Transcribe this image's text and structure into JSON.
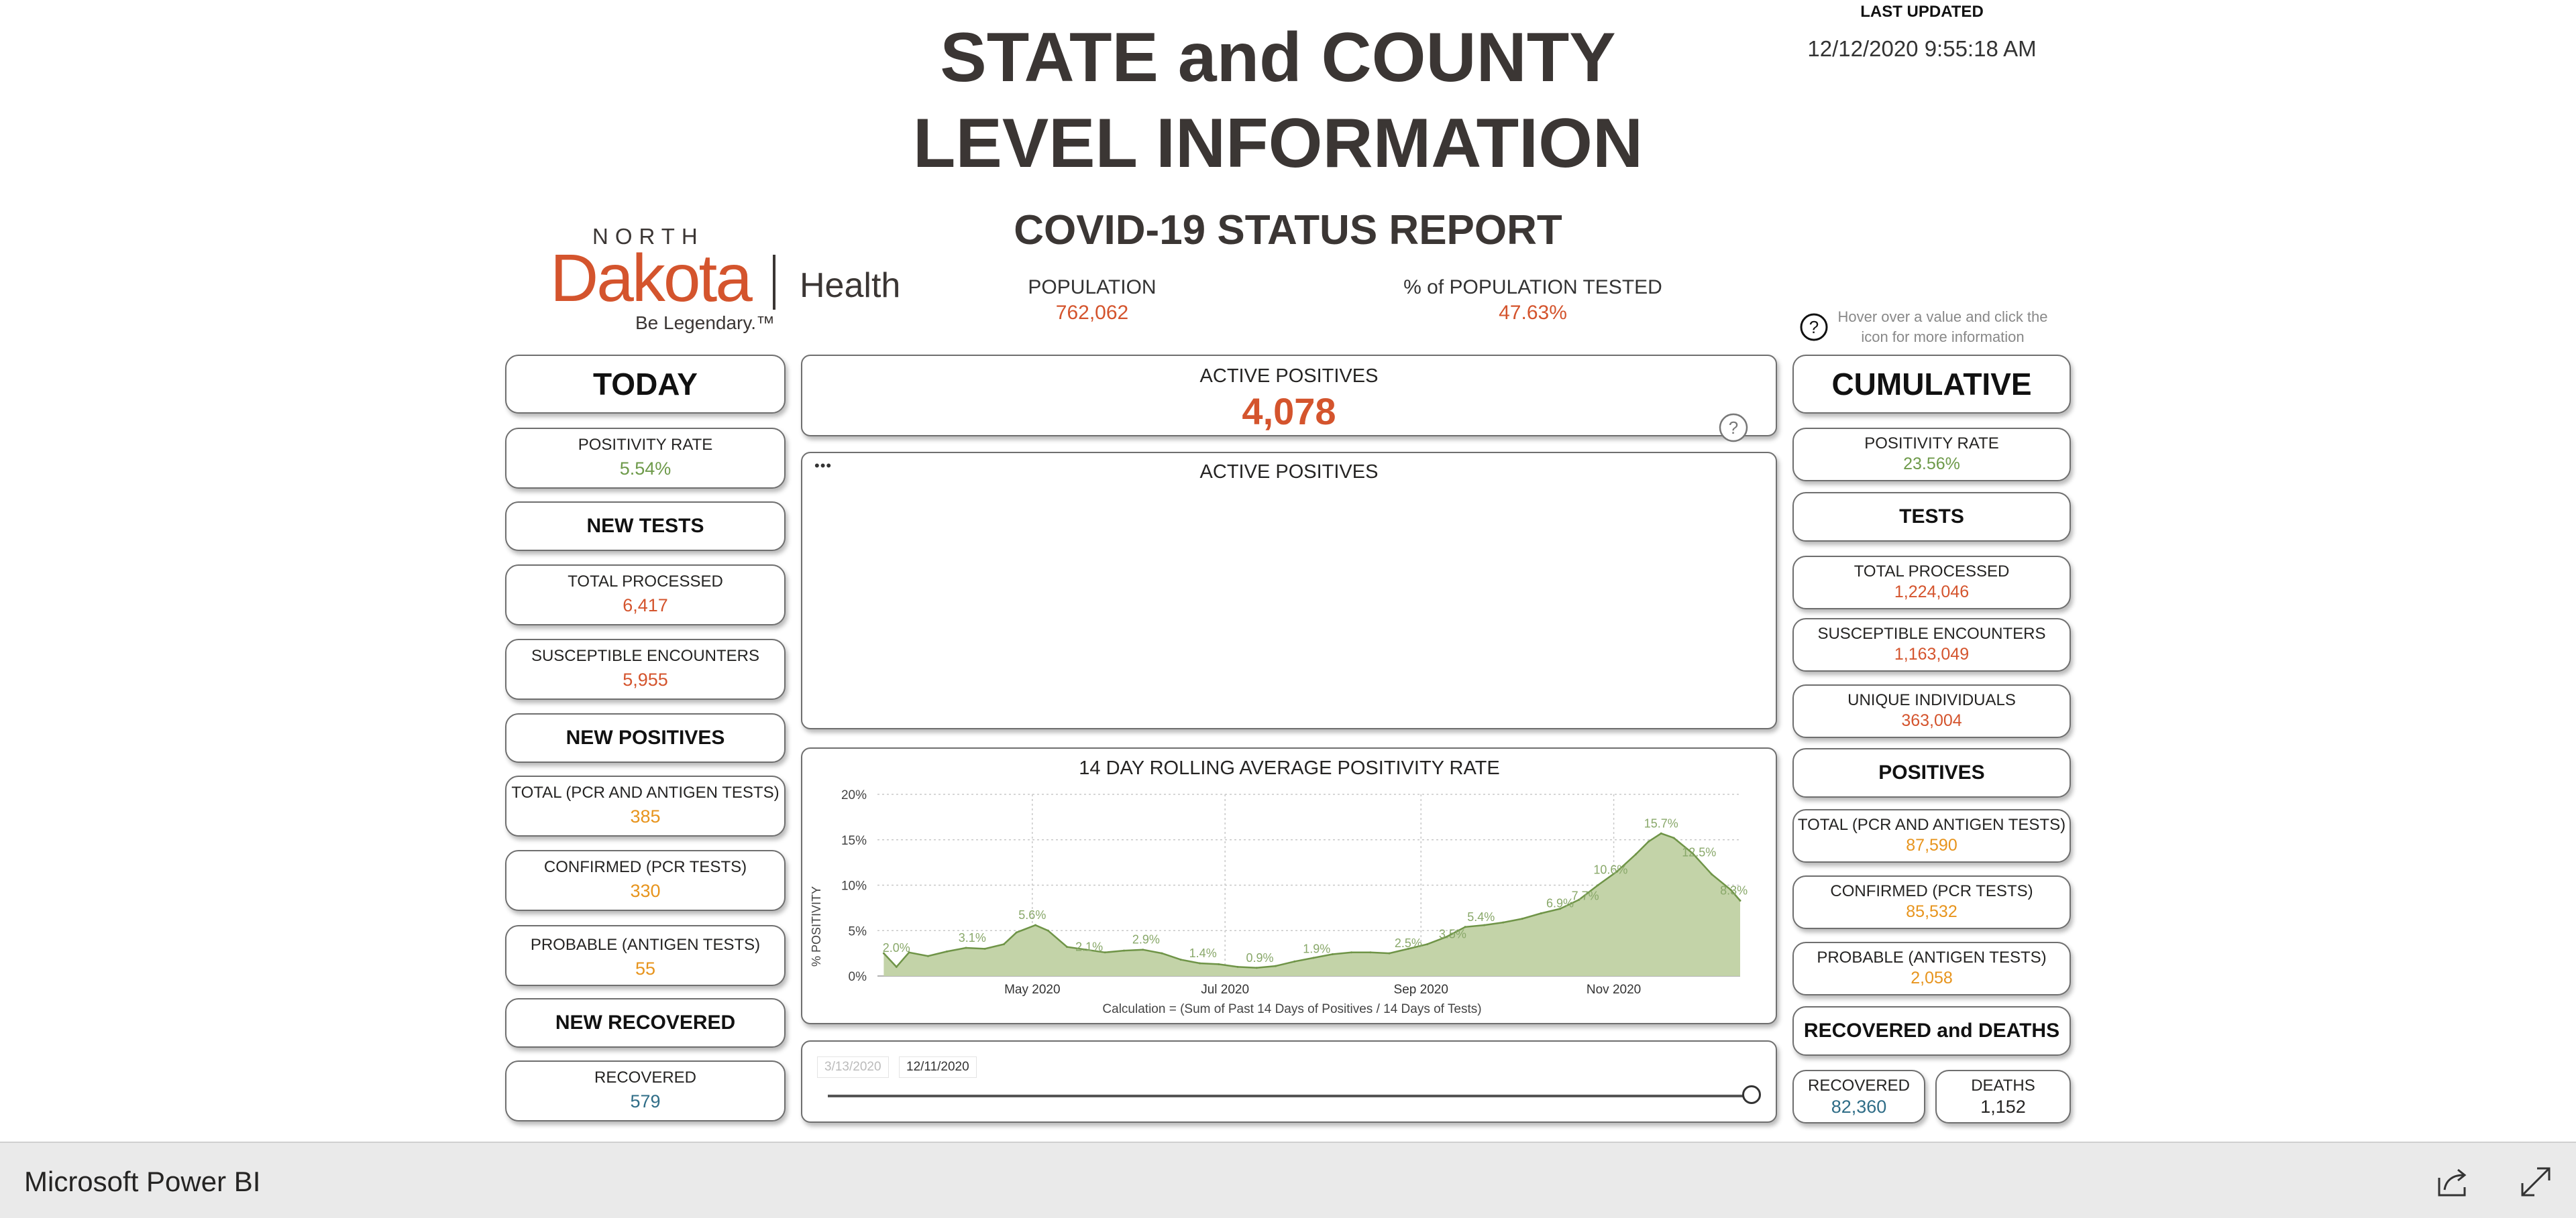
{
  "header": {
    "title_line1": "STATE and COUNTY",
    "title_line2": "LEVEL INFORMATION",
    "last_updated_label": "LAST UPDATED",
    "last_updated_value": "12/12/2020 9:55:18 AM"
  },
  "logo": {
    "north": "NORTH",
    "dakota": "Dakota",
    "health": "Health",
    "tagline": "Be Legendary.™"
  },
  "report": {
    "title": "COVID-19 STATUS REPORT",
    "population_label": "POPULATION",
    "population_value": "762,062",
    "pct_tested_label": "% of POPULATION TESTED",
    "pct_tested_value": "47.63%",
    "hint": "Hover over a value and click the icon for more information"
  },
  "today": {
    "title": "TODAY",
    "positivity_label": "POSITIVITY RATE",
    "positivity_value": "5.54%",
    "new_tests_title": "NEW TESTS",
    "total_processed_label": "TOTAL PROCESSED",
    "total_processed_value": "6,417",
    "susceptible_label": "SUSCEPTIBLE ENCOUNTERS",
    "susceptible_value": "5,955",
    "new_positives_title": "NEW POSITIVES",
    "total_label": "TOTAL (PCR AND ANTIGEN TESTS)",
    "total_value": "385",
    "confirmed_label": "CONFIRMED (PCR TESTS)",
    "confirmed_value": "330",
    "probable_label": "PROBABLE (ANTIGEN TESTS)",
    "probable_value": "55",
    "new_recovered_title": "NEW RECOVERED",
    "recovered_label": "RECOVERED",
    "recovered_value": "579"
  },
  "active": {
    "label": "ACTIVE POSITIVES",
    "value": "4,078",
    "panel_title": "ACTIVE POSITIVES"
  },
  "cumulative": {
    "title": "CUMULATIVE",
    "positivity_label": "POSITIVITY RATE",
    "positivity_value": "23.56%",
    "tests_title": "TESTS",
    "total_processed_label": "TOTAL PROCESSED",
    "total_processed_value": "1,224,046",
    "susceptible_label": "SUSCEPTIBLE ENCOUNTERS",
    "susceptible_value": "1,163,049",
    "unique_label": "UNIQUE INDIVIDUALS",
    "unique_value": "363,004",
    "positives_title": "POSITIVES",
    "total_label": "TOTAL (PCR AND ANTIGEN TESTS)",
    "total_value": "87,590",
    "confirmed_label": "CONFIRMED (PCR TESTS)",
    "confirmed_value": "85,532",
    "probable_label": "PROBABLE (ANTIGEN TESTS)",
    "probable_value": "2,058",
    "rec_deaths_title": "RECOVERED and DEATHS",
    "recovered_label": "RECOVERED",
    "recovered_value": "82,360",
    "deaths_label": "DEATHS",
    "deaths_value": "1,152"
  },
  "slider": {
    "start": "3/13/2020",
    "end": "12/11/2020",
    "position": 1.0
  },
  "footer": {
    "app_name": "Microsoft Power BI"
  },
  "icons": {
    "help": "help-circle-icon",
    "share": "share-icon",
    "fullscreen": "expand-icon",
    "more": "more-options-icon"
  },
  "colors": {
    "accent_red": "#d4542d",
    "accent_green": "#6e9a4a",
    "accent_orange": "#e7941d",
    "area_fill": "#c3d3a8",
    "area_line": "#6f9447"
  },
  "chart_data": {
    "type": "area",
    "title": "14 DAY ROLLING AVERAGE POSITIVITY RATE",
    "ylabel": "% POSITIVITY",
    "xlabel": "",
    "note": "Calculation = (Sum of Past 14 Days of Positives / 14 Days of Tests)",
    "ylim": [
      0,
      20
    ],
    "y_ticks": [
      "0%",
      "5%",
      "10%",
      "15%",
      "20%"
    ],
    "x_ticks": [
      {
        "date": "2020-05-01",
        "label": "May 2020"
      },
      {
        "date": "2020-07-01",
        "label": "Jul 2020"
      },
      {
        "date": "2020-09-01",
        "label": "Sep 2020"
      },
      {
        "date": "2020-11-01",
        "label": "Nov 2020"
      }
    ],
    "grid": true,
    "series": [
      {
        "x": [
          "2020-03-15",
          "2020-03-19",
          "2020-03-23",
          "2020-03-29",
          "2020-04-04",
          "2020-04-10",
          "2020-04-16",
          "2020-04-22",
          "2020-04-26",
          "2020-05-02",
          "2020-05-06",
          "2020-05-12",
          "2020-05-18",
          "2020-05-24",
          "2020-05-30",
          "2020-06-05",
          "2020-06-11",
          "2020-06-17",
          "2020-06-23",
          "2020-06-29",
          "2020-07-05",
          "2020-07-11",
          "2020-07-17",
          "2020-07-23",
          "2020-07-29",
          "2020-08-04",
          "2020-08-10",
          "2020-08-16",
          "2020-08-22",
          "2020-08-28",
          "2020-09-03",
          "2020-09-09",
          "2020-09-15",
          "2020-09-21",
          "2020-09-27",
          "2020-10-03",
          "2020-10-09",
          "2020-10-15",
          "2020-10-21",
          "2020-10-27",
          "2020-11-02",
          "2020-11-08",
          "2020-11-12",
          "2020-11-16",
          "2020-11-20",
          "2020-11-26",
          "2020-12-02",
          "2020-12-08",
          "2020-12-11"
        ],
        "values": [
          2.5,
          1.0,
          2.6,
          2.2,
          2.7,
          3.1,
          3.0,
          3.5,
          4.8,
          5.6,
          5.0,
          3.2,
          2.9,
          2.6,
          2.8,
          2.9,
          2.5,
          1.8,
          1.4,
          1.3,
          1.0,
          0.9,
          1.1,
          1.6,
          2.0,
          2.4,
          2.6,
          2.6,
          2.5,
          3.0,
          3.5,
          4.3,
          5.4,
          5.6,
          5.9,
          6.3,
          6.9,
          7.4,
          8.4,
          10.0,
          11.5,
          13.4,
          14.8,
          15.7,
          15.2,
          13.5,
          11.2,
          9.5,
          8.3
        ]
      }
    ],
    "data_labels": [
      {
        "date": "2020-03-19",
        "value": 2.0,
        "text": "2.0%"
      },
      {
        "date": "2020-04-12",
        "value": 3.1,
        "text": "3.1%"
      },
      {
        "date": "2020-05-01",
        "value": 5.6,
        "text": "5.6%"
      },
      {
        "date": "2020-05-19",
        "value": 2.1,
        "text": "2.1%"
      },
      {
        "date": "2020-06-06",
        "value": 2.9,
        "text": "2.9%"
      },
      {
        "date": "2020-06-24",
        "value": 1.4,
        "text": "1.4%"
      },
      {
        "date": "2020-07-12",
        "value": 0.9,
        "text": "0.9%"
      },
      {
        "date": "2020-07-30",
        "value": 1.9,
        "text": "1.9%"
      },
      {
        "date": "2020-08-28",
        "value": 2.5,
        "text": "2.5%"
      },
      {
        "date": "2020-09-11",
        "value": 3.5,
        "text": "3.5%"
      },
      {
        "date": "2020-09-20",
        "value": 5.4,
        "text": "5.4%"
      },
      {
        "date": "2020-10-15",
        "value": 6.9,
        "text": "6.9%"
      },
      {
        "date": "2020-10-23",
        "value": 7.7,
        "text": "7.7%"
      },
      {
        "date": "2020-10-31",
        "value": 10.6,
        "text": "10.6%"
      },
      {
        "date": "2020-11-16",
        "value": 15.7,
        "text": "15.7%"
      },
      {
        "date": "2020-11-28",
        "value": 12.5,
        "text": "12.5%"
      },
      {
        "date": "2020-12-09",
        "value": 8.3,
        "text": "8.3%"
      }
    ]
  }
}
